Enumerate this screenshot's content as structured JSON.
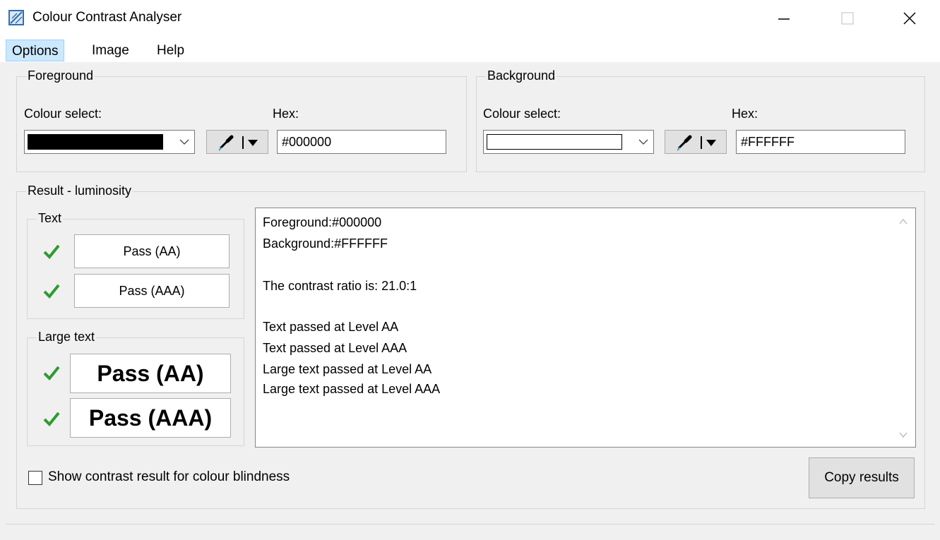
{
  "window": {
    "title": "Colour Contrast Analyser"
  },
  "menu": {
    "options": "Options",
    "image": "Image",
    "help": "Help"
  },
  "foreground": {
    "legend": "Foreground",
    "colour_select_label": "Colour select:",
    "hex_label": "Hex:",
    "hex_value": "#000000",
    "swatch_color": "#000000"
  },
  "background": {
    "legend": "Background",
    "colour_select_label": "Colour select:",
    "hex_label": "Hex:",
    "hex_value": "#FFFFFF",
    "swatch_color": "#FFFFFF"
  },
  "result": {
    "legend": "Result - luminosity",
    "text_legend": "Text",
    "large_text_legend": "Large text",
    "text_aa": "Pass (AA)",
    "text_aaa": "Pass (AAA)",
    "large_aa": "Pass (AA)",
    "large_aaa": "Pass (AAA)",
    "check_color": "#2e9b2e",
    "lines": {
      "fg": "Foreground:#000000",
      "bg": "Background:#FFFFFF",
      "ratio": "The contrast ratio is: 21.0:1",
      "l1": "Text passed at Level AA",
      "l2": "Text passed at Level AAA",
      "l3": "Large text passed at Level AA",
      "l4": "Large text passed at Level AAA"
    }
  },
  "options": {
    "colour_blindness_label": "Show contrast result for colour blindness",
    "colour_blindness_checked": false
  },
  "buttons": {
    "copy_results": "Copy results"
  }
}
